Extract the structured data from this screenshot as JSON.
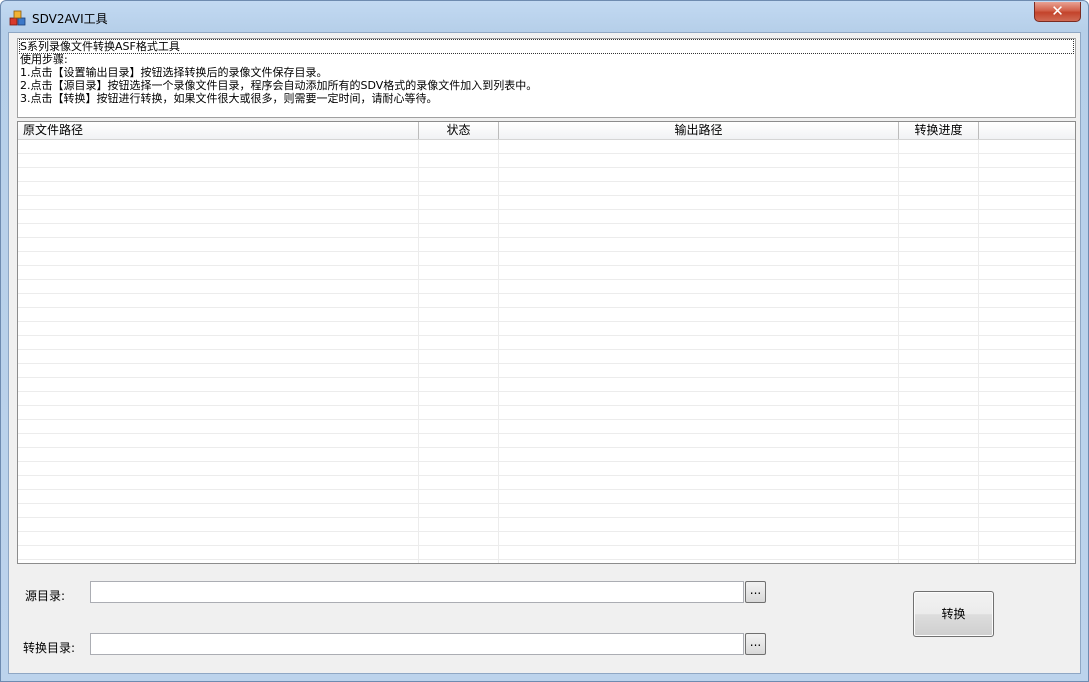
{
  "window": {
    "title": "SDV2AVI工具",
    "close_label": "✕"
  },
  "instructions": {
    "lines": [
      "S系列录像文件转换ASF格式工具",
      "使用步骤:",
      "1.点击【设置输出目录】按钮选择转换后的录像文件保存目录。",
      "2.点击【源目录】按钮选择一个录像文件目录，程序会自动添加所有的SDV格式的录像文件加入到列表中。",
      "3.点击【转换】按钮进行转换，如果文件很大或很多，则需要一定时间，请耐心等待。"
    ]
  },
  "file_list": {
    "columns": [
      "原文件路径",
      "状态",
      "输出路径",
      "转换进度"
    ],
    "rows": []
  },
  "source_dir": {
    "label": "源目录:",
    "value": "",
    "browse_label": "..."
  },
  "output_dir": {
    "label": "转换目录:",
    "value": "",
    "browse_label": "..."
  },
  "convert_button": {
    "label": "转换"
  },
  "colors": {
    "title_gradient_top": "#c2d9f2",
    "client_bg": "#f0f0f0",
    "close_red": "#c3432b"
  }
}
